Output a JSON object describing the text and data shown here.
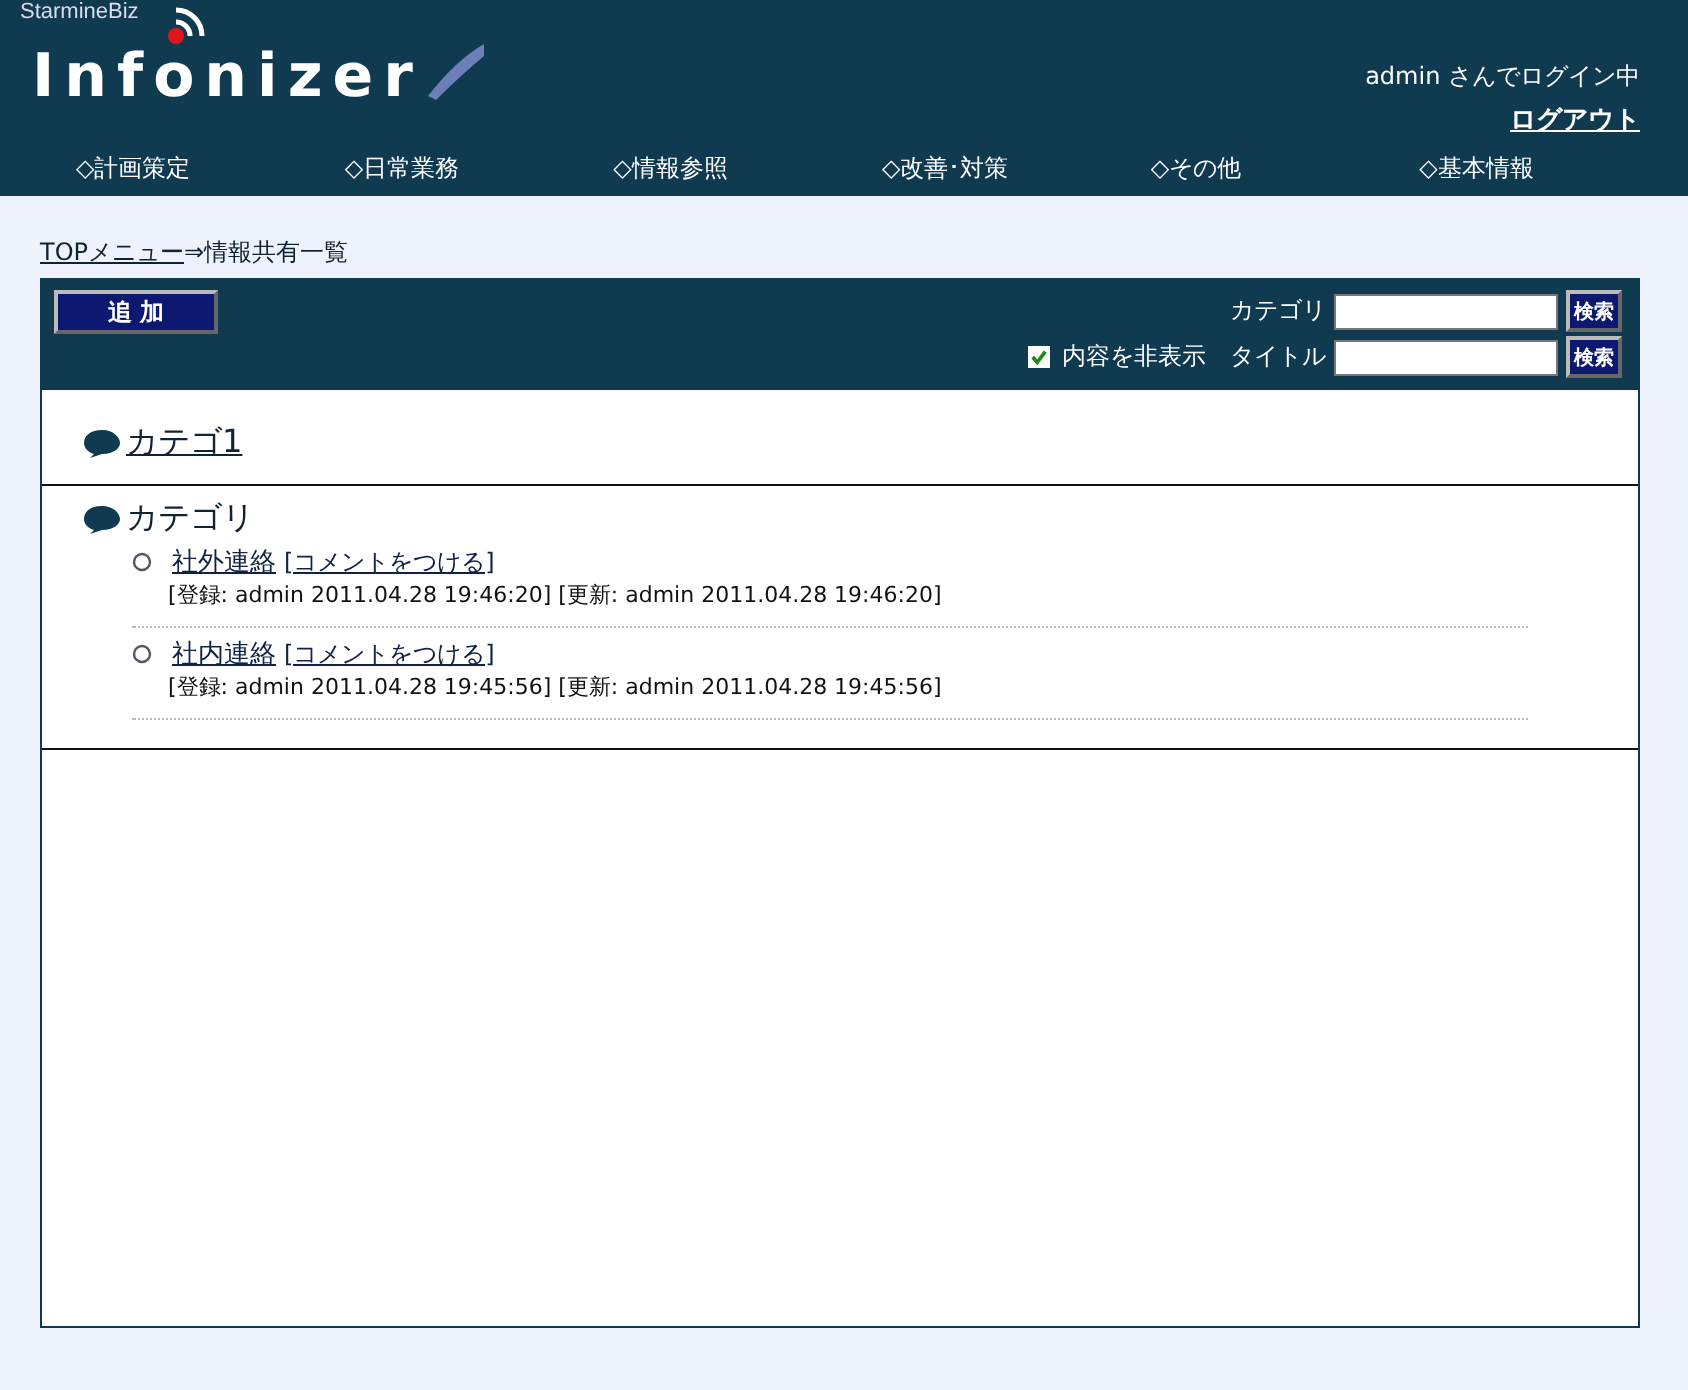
{
  "header": {
    "brand": "StarmineBiz",
    "logo": "Infonizer",
    "user": "admin さんでログイン中",
    "logout": "ログアウト"
  },
  "nav": [
    "◇計画策定",
    "◇日常業務",
    "◇情報参照",
    "◇改善･対策",
    "◇その他",
    "◇基本情報"
  ],
  "breadcrumb": {
    "link": "TOPメニュー",
    "rest": "⇒情報共有一覧"
  },
  "toolbar": {
    "add": "追 加",
    "hide_content": {
      "label": "内容を非表示",
      "checked": true
    },
    "filters": [
      {
        "label": "カテゴリ",
        "button": "検索"
      },
      {
        "label": "タイトル",
        "button": "検索"
      }
    ]
  },
  "categories": [
    {
      "name": "カテゴ1",
      "link": true
    },
    {
      "name": "カテゴリ",
      "link": false,
      "items": [
        {
          "title": "社外連絡",
          "comment": "[コメントをつける]",
          "meta": "[登録: admin 2011.04.28 19:46:20] [更新: admin 2011.04.28 19:46:20]"
        },
        {
          "title": "社内連絡",
          "comment": "[コメントをつける]",
          "meta": "[登録: admin 2011.04.28 19:45:56] [更新: admin 2011.04.28 19:45:56]"
        }
      ]
    }
  ]
}
